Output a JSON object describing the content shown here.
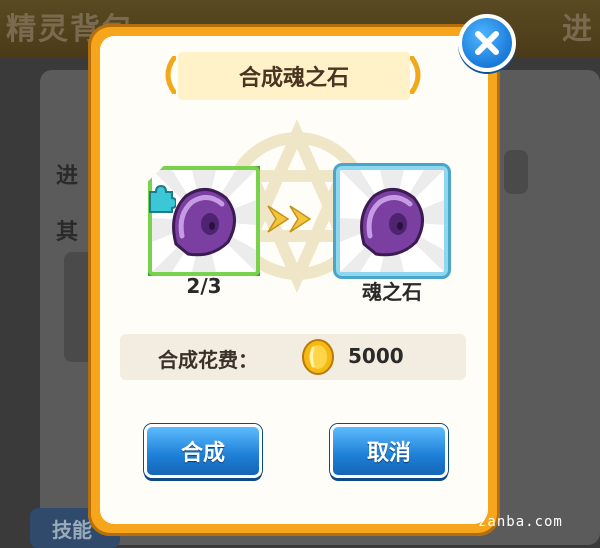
{
  "background": {
    "top_text_left": "精灵背包",
    "top_text_right": "进",
    "row1_text": "进",
    "row2_text": "其",
    "side_button": "技能"
  },
  "dialog": {
    "title": "合成魂之石",
    "source_item": {
      "count_text": "2/3",
      "icon": "purple-soul-stone-fragment"
    },
    "target_item": {
      "name": "魂之石",
      "icon": "purple-soul-stone"
    },
    "cost": {
      "label": "合成花费：",
      "currency_icon": "gold-coin",
      "amount": "5000"
    },
    "buttons": {
      "compose": "合成",
      "cancel": "取消"
    },
    "close_icon": "close-x"
  },
  "watermark": "zanba.com",
  "colors": {
    "frame": "#f7a51a",
    "button_blue": "#1d7fd6",
    "source_border": "#79d24c",
    "target_border": "#8fd6f0",
    "gem_purple": "#7a3fa0"
  }
}
